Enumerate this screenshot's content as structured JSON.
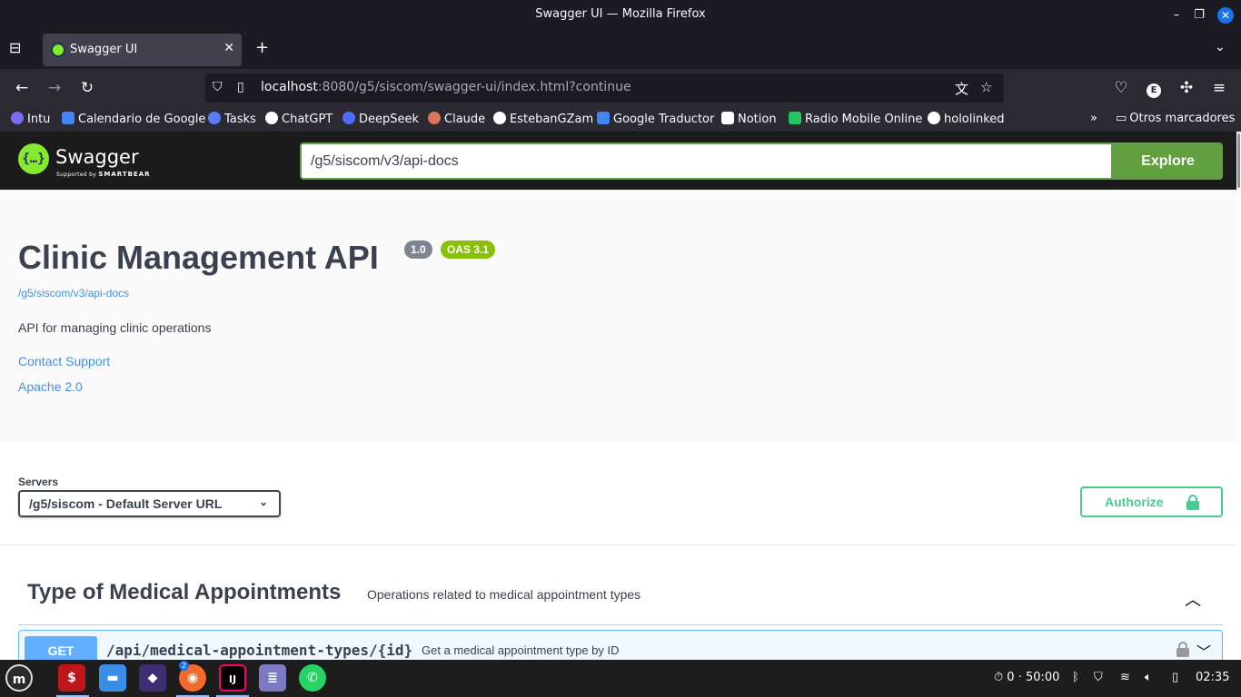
{
  "window": {
    "title": "Swagger UI — Mozilla Firefox"
  },
  "tab": {
    "label": "Swagger UI"
  },
  "address_bar": {
    "host": "localhost",
    "rest": ":8080/g5/siscom/swagger-ui/index.html?continue"
  },
  "bookmarks": [
    {
      "label": "Intu",
      "color": "#7b6cf6"
    },
    {
      "label": "Calendario de Google",
      "color": "#4285f4"
    },
    {
      "label": "Tasks",
      "color": "#5b7cf7"
    },
    {
      "label": "ChatGPT",
      "color": "#ffffff"
    },
    {
      "label": "DeepSeek",
      "color": "#4d6bfe"
    },
    {
      "label": "Claude",
      "color": "#d97757"
    },
    {
      "label": "EstebanGZam",
      "color": "#ffffff"
    },
    {
      "label": "Google Traductor",
      "color": "#4285f4"
    },
    {
      "label": "Notion",
      "color": "#ffffff"
    },
    {
      "label": "Radio Mobile Online",
      "color": "#22c55e"
    },
    {
      "label": "hololinked",
      "color": "#ffffff"
    }
  ],
  "other_bookmarks": "Otros marcadores",
  "swagger": {
    "logo_text": "Swagger",
    "supported_by": "Supported by",
    "smartbear": "SMARTBEAR",
    "spec_url": "/g5/siscom/v3/api-docs",
    "explore_label": "Explore"
  },
  "info": {
    "title": "Clinic Management API",
    "version": "1.0",
    "oas": "OAS 3.1",
    "spec_link": "/g5/siscom/v3/api-docs",
    "description": "API for managing clinic operations",
    "contact": "Contact Support",
    "license": "Apache 2.0"
  },
  "servers": {
    "label": "Servers",
    "selected": "/g5/siscom - Default Server URL",
    "authorize_label": "Authorize"
  },
  "tag": {
    "name": "Type of Medical Appointments",
    "description": "Operations related to medical appointment types"
  },
  "operation": {
    "method": "GET",
    "path": "/api/medical-appointment-types/{id}",
    "summary": "Get a medical appointment type by ID"
  },
  "taskbar": {
    "badge": "2",
    "timer": "0 · 50:00",
    "clock": "02:35"
  }
}
